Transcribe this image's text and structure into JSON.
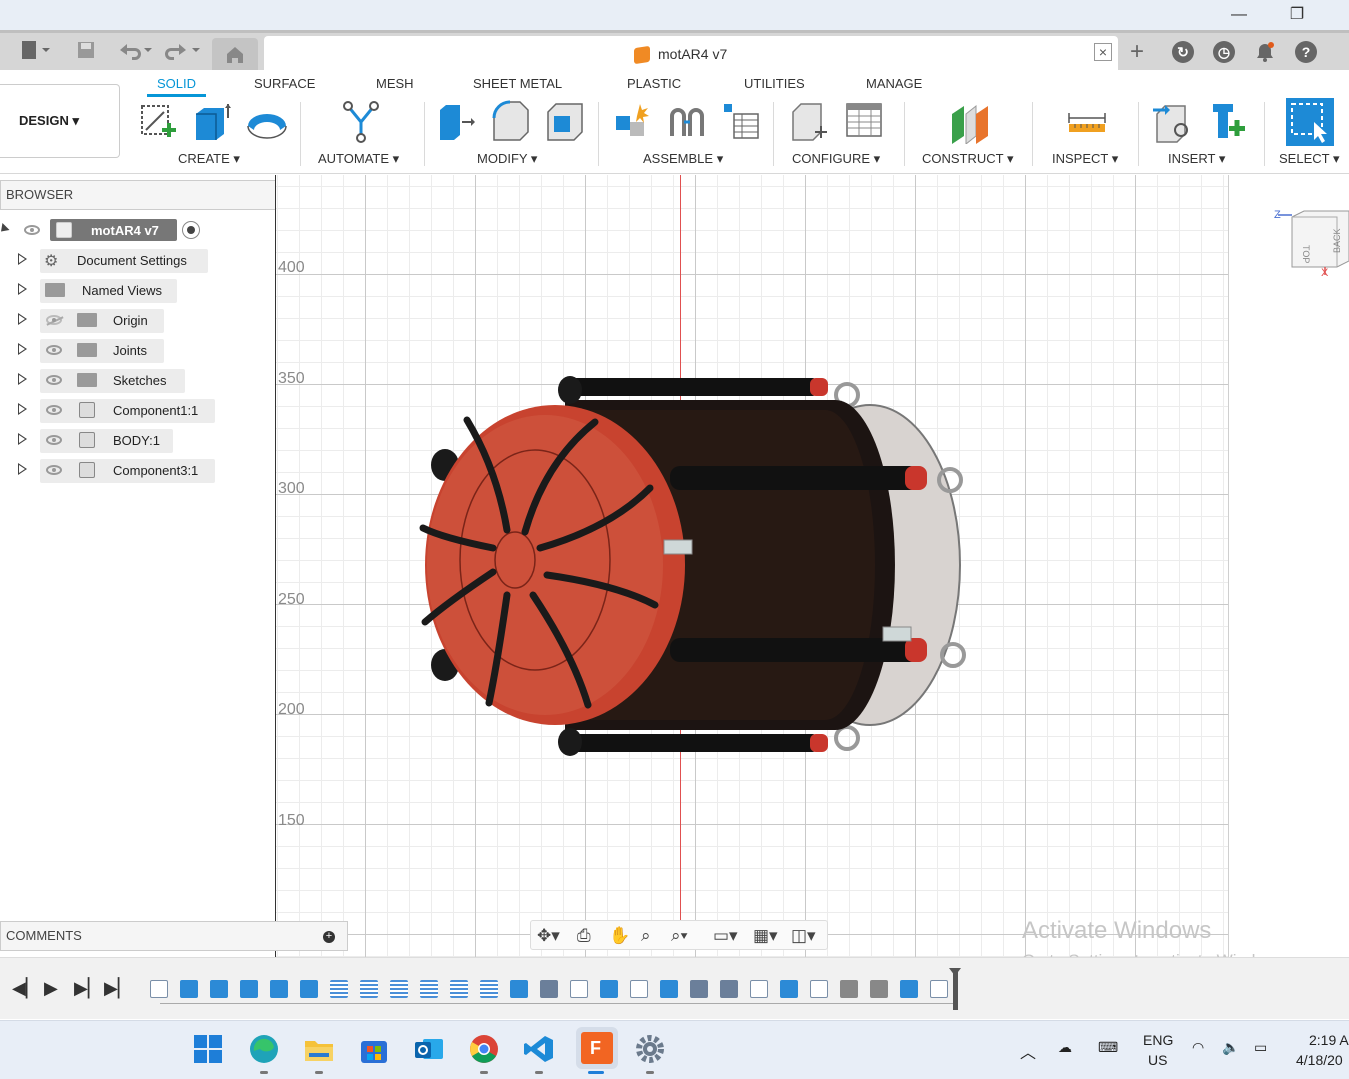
{
  "window": {
    "minimize_glyph": "—",
    "restore_glyph": "❐"
  },
  "tabs": {
    "document_title": "motAR4 v7",
    "close_glyph": "×",
    "new_tab_glyph": "+"
  },
  "ribbon": {
    "workspace_button": "DESIGN ▾",
    "tabs": [
      "SOLID",
      "SURFACE",
      "MESH",
      "SHEET METAL",
      "PLASTIC",
      "UTILITIES",
      "MANAGE"
    ],
    "active_tab": "SOLID",
    "groups": [
      "CREATE ▾",
      "AUTOMATE ▾",
      "MODIFY ▾",
      "ASSEMBLE ▾",
      "CONFIGURE ▾",
      "CONSTRUCT ▾",
      "INSPECT ▾",
      "INSERT ▾",
      "SELECT ▾"
    ]
  },
  "browser": {
    "title": "BROWSER",
    "root": "motAR4 v7",
    "nodes": [
      {
        "label": "Document Settings",
        "icon": "gear-icon"
      },
      {
        "label": "Named Views",
        "icon": "folder-icon"
      },
      {
        "label": "Origin",
        "icon": "folder-icon",
        "hidden": true
      },
      {
        "label": "Joints",
        "icon": "folder-icon"
      },
      {
        "label": "Sketches",
        "icon": "folder-icon"
      },
      {
        "label": "Component1:1",
        "icon": "component-icon"
      },
      {
        "label": "BODY:1",
        "icon": "component-icon"
      },
      {
        "label": "Component3:1",
        "icon": "component-icon"
      }
    ]
  },
  "comments": {
    "title": "COMMENTS"
  },
  "viewport": {
    "ruler_labels": [
      "400",
      "350",
      "300",
      "250",
      "200",
      "150"
    ],
    "viewcube": {
      "axis_z": "Z",
      "axis_x": "X",
      "face_top": "TOP",
      "face_back": "BACK"
    }
  },
  "watermark": {
    "line1": "Activate Windows",
    "line2": "Go to Settings to activate Windows."
  },
  "taskbar": {
    "language": "ENG",
    "region": "US",
    "time": "2:19 A",
    "date": "4/18/20"
  },
  "colors": {
    "accent": "#0696d7",
    "model_red": "#c0392b",
    "model_dark": "#1a1a1a"
  }
}
